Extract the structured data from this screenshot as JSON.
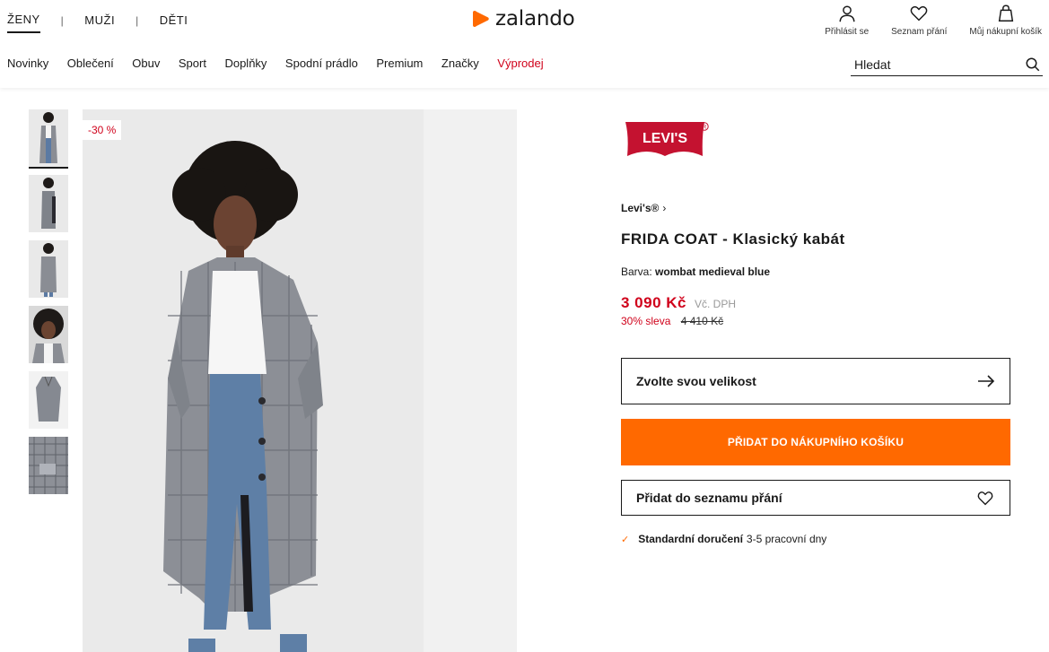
{
  "header": {
    "gender_tabs": [
      {
        "label": "ŽENY",
        "active": true
      },
      {
        "label": "MUŽI",
        "active": false
      },
      {
        "label": "DĚTI",
        "active": false
      }
    ],
    "separator": "|",
    "logo_text": "zalando",
    "user_nav": [
      {
        "label": "Přihlásit se",
        "icon": "user-icon"
      },
      {
        "label": "Seznam přání",
        "icon": "heart-icon"
      },
      {
        "label": "Můj nákupní košík",
        "icon": "bag-icon"
      }
    ],
    "categories": [
      "Novinky",
      "Oblečení",
      "Obuv",
      "Sport",
      "Doplňky",
      "Spodní prádlo",
      "Premium",
      "Značky",
      "Výprodej"
    ],
    "search": {
      "placeholder": "Hledat",
      "icon": "search-icon"
    }
  },
  "gallery": {
    "badge": "-30 %",
    "thumbnail_count": 6
  },
  "product": {
    "brand_logo_text": "LEVI'S",
    "brand_link": "Levi's®",
    "title": "FRIDA COAT - Klasický kabát",
    "color_label": "Barva:",
    "color_value": "wombat medieval blue",
    "price": "3 090 Kč",
    "vat_note": "Vč. DPH",
    "discount_text": "30% sleva",
    "old_price": "4 410 Kč",
    "size_button": "Zvolte svou velikost",
    "add_to_cart": "PŘIDAT DO NÁKUPNÍHO KOŠÍKU",
    "wishlist_button": "Přidat do seznamu přání",
    "delivery_label": "Standardní doručení",
    "delivery_time": "3-5 pracovní dny"
  },
  "colors": {
    "accent": "#ff6900",
    "sale": "#d0021b",
    "brand_red": "#c41230"
  }
}
